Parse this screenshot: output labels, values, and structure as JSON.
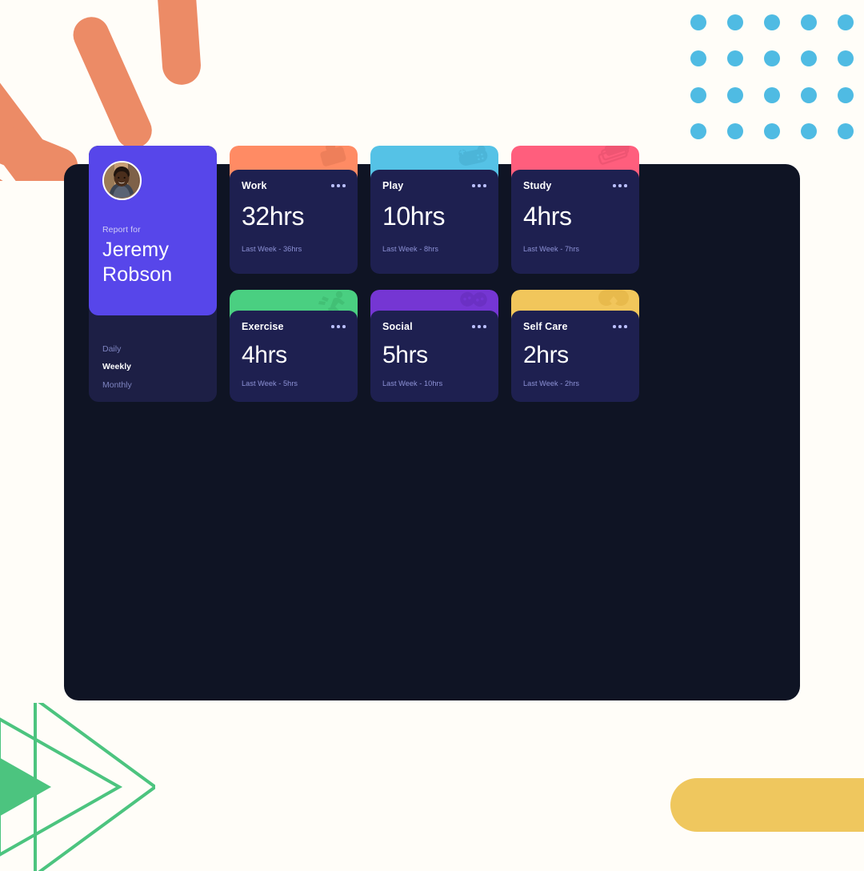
{
  "decor": {
    "orange_color": "#EC8B66",
    "dot_color": "#4FBBE3",
    "green_color": "#4CC47F",
    "yellow_color": "#EFC75E",
    "page_background": "#FFFDF8",
    "dot_grid_columns": 5,
    "dot_grid_rows": 4
  },
  "panel": {
    "background": "#0F1424"
  },
  "profile": {
    "avatar_alt": "user-avatar-photo",
    "report_label": "Report for",
    "name": "Jeremy\nRobson",
    "name_line1": "Jeremy",
    "name_line2": "Robson",
    "card_color": "#5746EA",
    "nav": [
      {
        "label": "Daily",
        "active": false
      },
      {
        "label": "Weekly",
        "active": true
      },
      {
        "label": "Monthly",
        "active": false
      }
    ]
  },
  "cards": [
    {
      "id": "work",
      "title": "Work",
      "value": "32hrs",
      "previous": "Last Week - 36hrs",
      "accent": "#FF8B64",
      "icon": "briefcase-icon",
      "menu": "ellipsis-icon"
    },
    {
      "id": "play",
      "title": "Play",
      "value": "10hrs",
      "previous": "Last Week - 8hrs",
      "accent": "#55C2E6",
      "icon": "game-controller-icon",
      "menu": "ellipsis-icon"
    },
    {
      "id": "study",
      "title": "Study",
      "value": "4hrs",
      "previous": "Last Week - 7hrs",
      "accent": "#FF5E7D",
      "icon": "books-icon",
      "menu": "ellipsis-icon"
    },
    {
      "id": "exercise",
      "title": "Exercise",
      "value": "4hrs",
      "previous": "Last Week - 5hrs",
      "accent": "#4ACF81",
      "icon": "running-person-icon",
      "menu": "ellipsis-icon"
    },
    {
      "id": "social",
      "title": "Social",
      "value": "5hrs",
      "previous": "Last Week - 10hrs",
      "accent": "#7536D3",
      "icon": "chat-bubbles-icon",
      "menu": "ellipsis-icon"
    },
    {
      "id": "selfcare",
      "title": "Self Care",
      "value": "2hrs",
      "previous": "Last Week - 2hrs",
      "accent": "#F1C65B",
      "icon": "flower-icon",
      "menu": "ellipsis-icon"
    }
  ]
}
